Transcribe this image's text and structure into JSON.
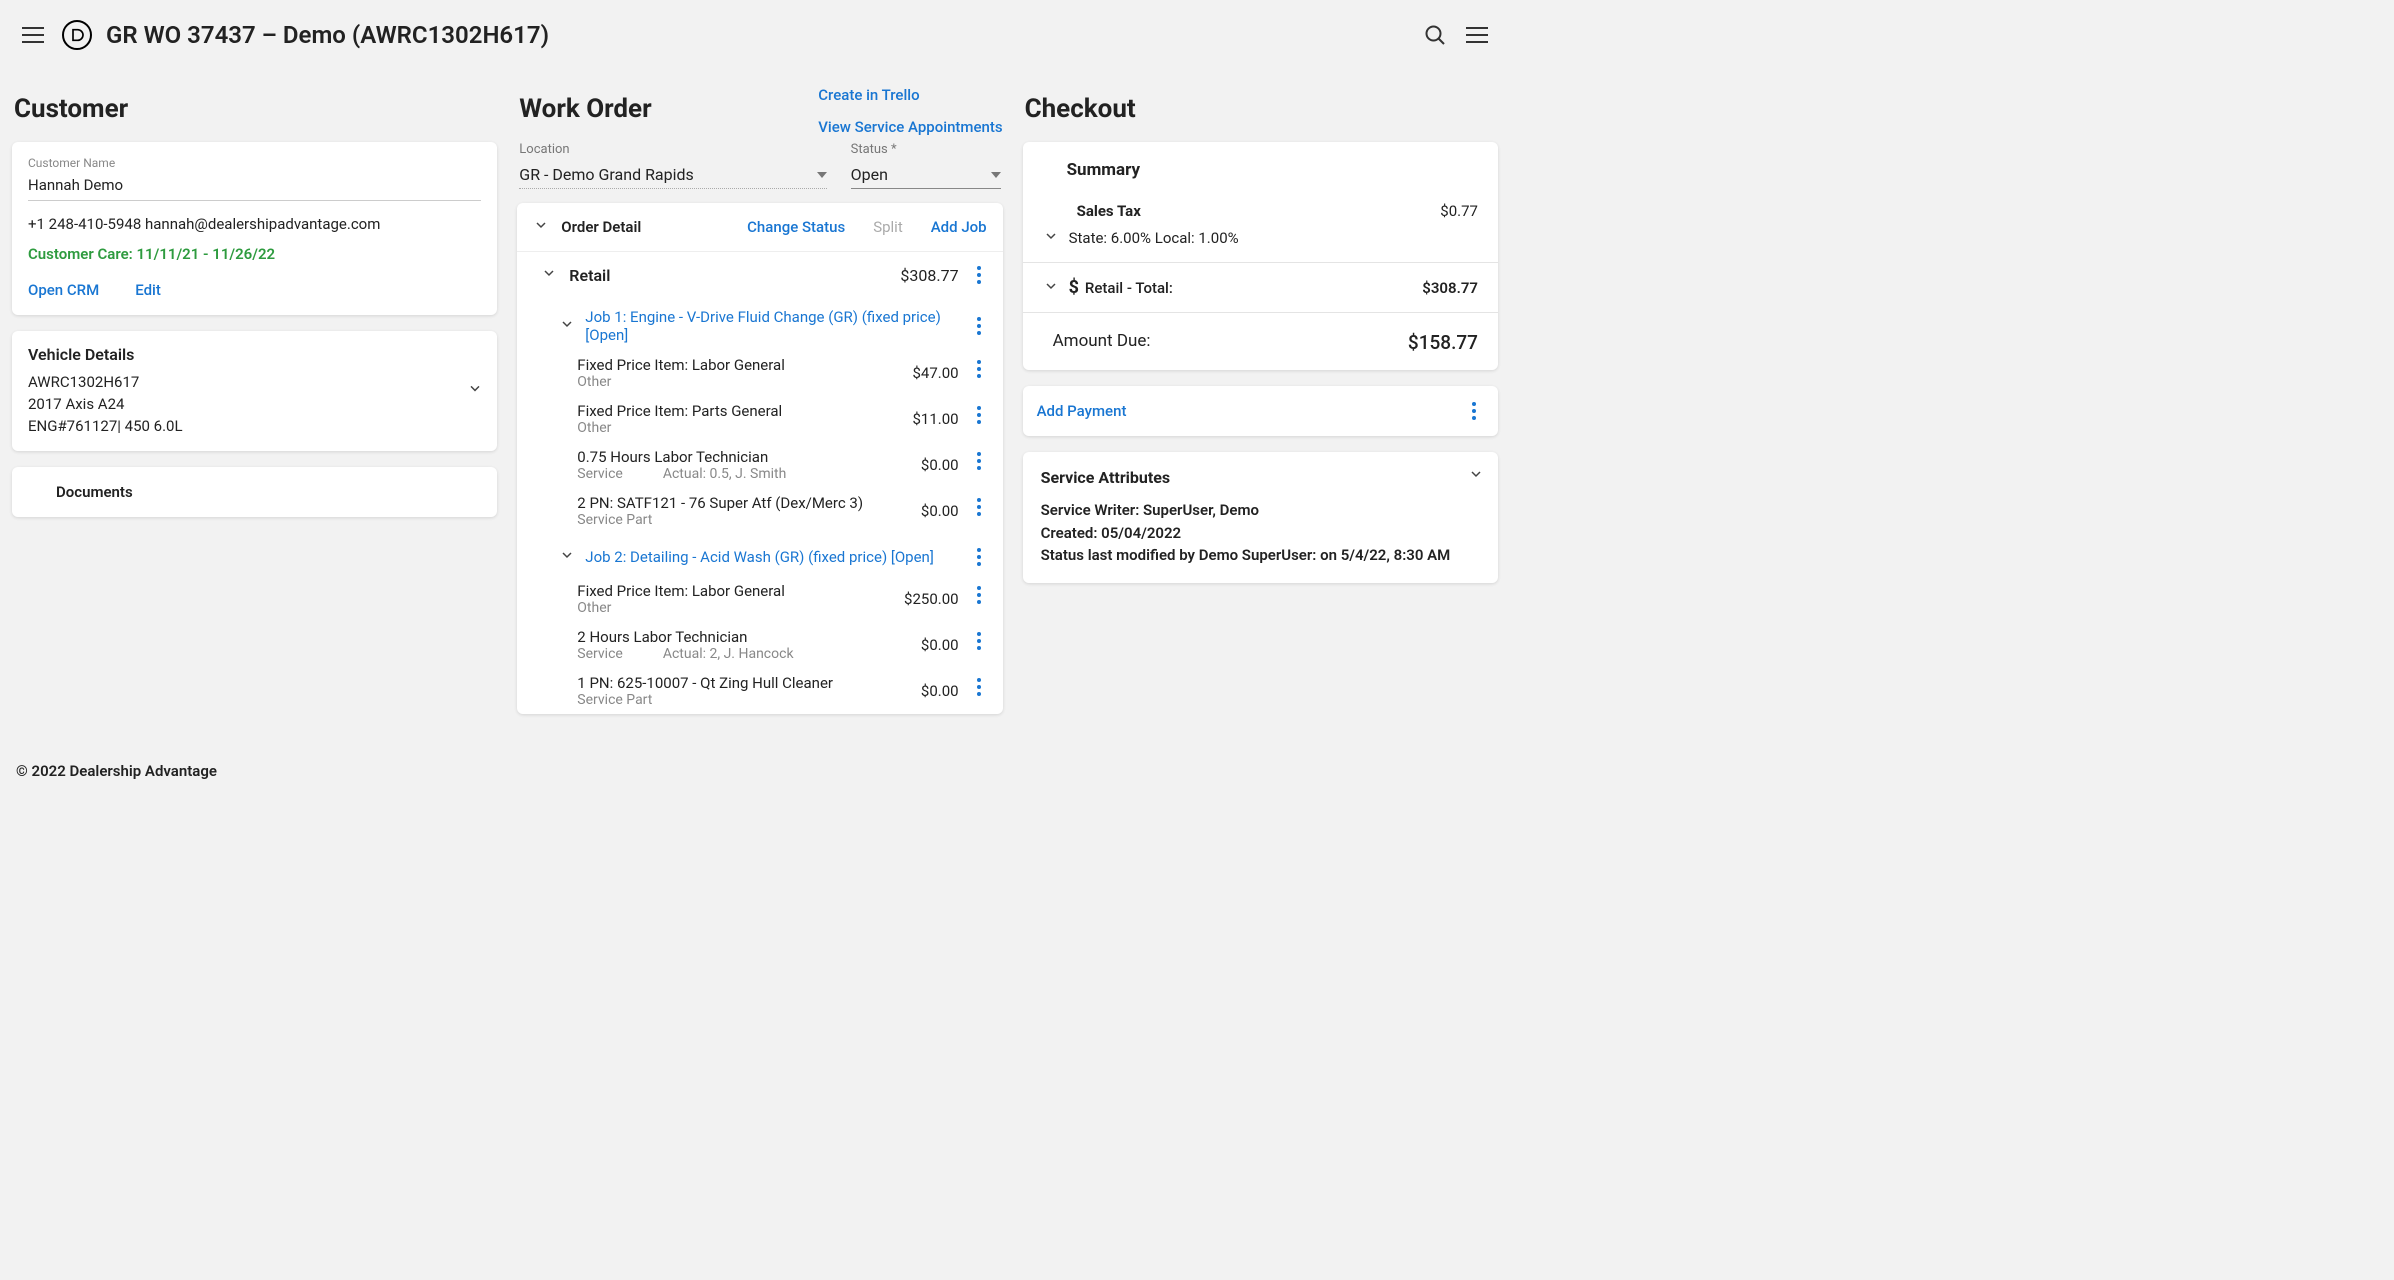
{
  "header": {
    "title": "GR WO 37437 – Demo (AWRC1302H617)"
  },
  "customer": {
    "section_title": "Customer",
    "name_label": "Customer Name",
    "name": "Hannah Demo",
    "phone": "+1 248-410-5948",
    "email": "hannah@dealershipadvantage.com",
    "care": "Customer Care: 11/11/21 - 11/26/22",
    "open_crm": "Open CRM",
    "edit": "Edit",
    "vehicle": {
      "title": "Vehicle Details",
      "vin": "AWRC1302H617",
      "model": "2017 Axis A24",
      "engine": "ENG#761127| 450 6.0L"
    },
    "documents": "Documents"
  },
  "workorder": {
    "section_title": "Work Order",
    "trello_link": "Create in Trello",
    "appt_link": "View Service Appointments",
    "location_label": "Location",
    "location_value": "GR - Demo Grand Rapids",
    "status_label": "Status *",
    "status_value": "Open",
    "order_detail_label": "Order Detail",
    "change_status": "Change Status",
    "split": "Split",
    "add_job": "Add Job",
    "retail_label": "Retail",
    "retail_total": "$308.77",
    "jobs": [
      {
        "title": "Job 1: Engine - V-Drive Fluid Change (GR) (fixed price) [Open]",
        "items": [
          {
            "title": "Fixed Price Item: Labor General",
            "sub1": "Other",
            "sub2": "",
            "amt": "$47.00"
          },
          {
            "title": "Fixed Price Item: Parts General",
            "sub1": "Other",
            "sub2": "",
            "amt": "$11.00"
          },
          {
            "title": "0.75 Hours Labor Technician",
            "sub1": "Service",
            "sub2": "Actual: 0.5, J. Smith",
            "amt": "$0.00"
          },
          {
            "title": "2 PN: SATF121 - 76 Super Atf (Dex/Merc 3)",
            "sub1": "Service Part",
            "sub2": "",
            "amt": "$0.00"
          }
        ]
      },
      {
        "title": "Job 2: Detailing - Acid Wash (GR) (fixed price) [Open]",
        "items": [
          {
            "title": "Fixed Price Item: Labor General",
            "sub1": "Other",
            "sub2": "",
            "amt": "$250.00"
          },
          {
            "title": "2 Hours Labor Technician",
            "sub1": "Service",
            "sub2": "Actual: 2, J. Hancock",
            "amt": "$0.00"
          },
          {
            "title": "1 PN: 625-10007 - Qt Zing Hull Cleaner",
            "sub1": "Service Part",
            "sub2": "",
            "amt": "$0.00"
          }
        ]
      }
    ]
  },
  "checkout": {
    "section_title": "Checkout",
    "summary_label": "Summary",
    "sales_tax_label": "Sales Tax",
    "sales_tax_value": "$0.77",
    "tax_detail": "State: 6.00%   Local: 1.00%",
    "retail_total_label": "Retail - Total:",
    "retail_total_value": "$308.77",
    "amount_due_label": "Amount Due:",
    "amount_due_value": "$158.77",
    "add_payment": "Add Payment",
    "attributes": {
      "title": "Service Attributes",
      "writer": "Service Writer: SuperUser, Demo",
      "created": "Created: 05/04/2022",
      "status_mod": "Status last modified by Demo SuperUser: on 5/4/22, 8:30 AM"
    }
  },
  "footer": "© 2022 Dealership Advantage"
}
